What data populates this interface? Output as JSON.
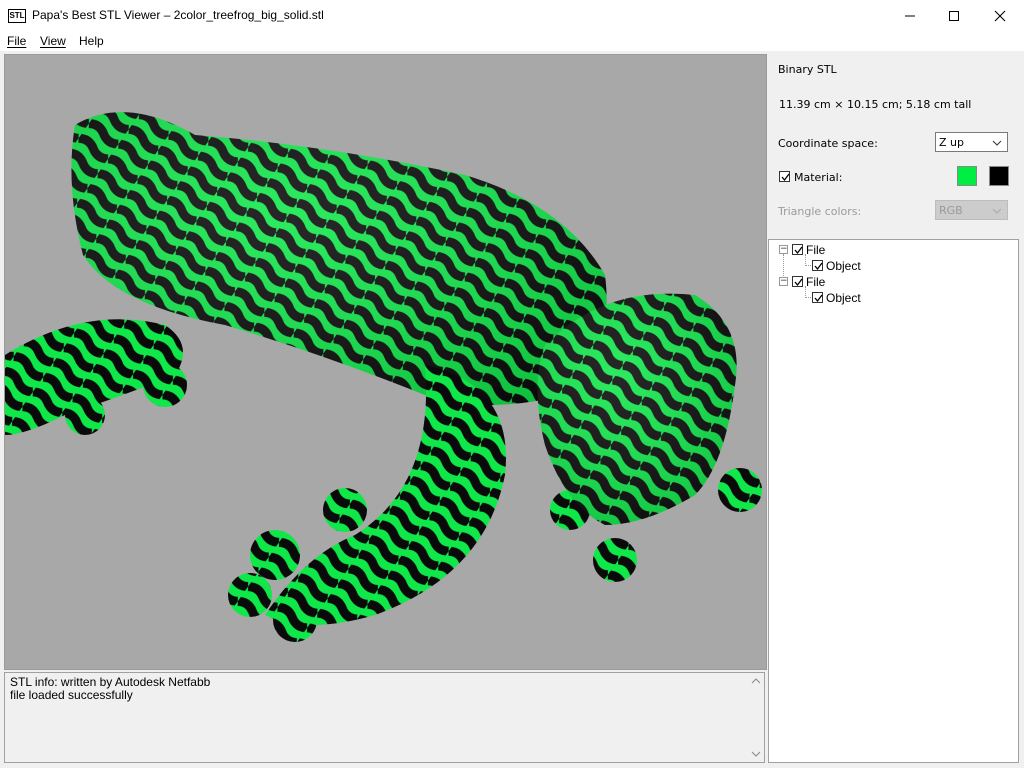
{
  "window": {
    "title": "Papa's Best STL Viewer – 2color_treefrog_big_solid.stl",
    "app_icon_label": "STL"
  },
  "menu": {
    "file": "File",
    "view": "View",
    "help": "Help"
  },
  "info": {
    "format": "Binary STL",
    "dimensions": "11.39 cm × 10.15 cm; 5.18 cm tall",
    "coordinate_label": "Coordinate space:",
    "coordinate_value": "Z up",
    "material_label": "Material:",
    "material_checked": true,
    "triangle_colors_label": "Triangle colors:",
    "triangle_colors_value": "RGB"
  },
  "colors": {
    "primary": "#00ee44",
    "secondary": "#000000"
  },
  "tree": [
    {
      "label": "File",
      "children": [
        {
          "label": "Object"
        }
      ]
    },
    {
      "label": "File",
      "children": [
        {
          "label": "Object"
        }
      ]
    }
  ],
  "tree_labels": {
    "file_1": "File",
    "object_1": "Object",
    "file_2": "File",
    "object_2": "Object"
  },
  "log": {
    "line1": "STL info: written by Autodesk Netfabb",
    "line2": "file loaded successfully"
  }
}
